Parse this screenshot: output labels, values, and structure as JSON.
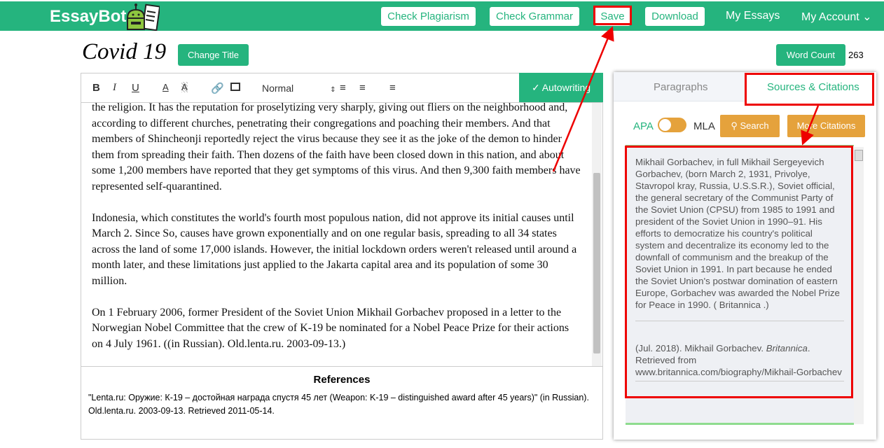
{
  "nav": {
    "brand": "EssayBot",
    "check_plagiarism": "Check Plagiarism",
    "check_grammar": "Check Grammar",
    "save": "Save",
    "download": "Download",
    "my_essays": "My Essays",
    "my_account": "My Account"
  },
  "header": {
    "title": "Covid 19",
    "change_title": "Change Title",
    "word_count_label": "Word Count",
    "word_count": "263"
  },
  "toolbar": {
    "format": "Normal",
    "autowriting": "Autowriting"
  },
  "essay": {
    "paragraphs": [
      "the religion. It has the reputation for proselytizing very sharply, giving out fliers on the neighborhood and, according to different churches, penetrating their congregations and poaching their members. And that members of Shincheonji reportedly reject the virus because they see it as the joke of the demon to hinder them from spreading their faith. Then dozens of the faith have been closed down in this nation, and about some 1,200 members have reported that they get symptoms of this virus. And then 9,300 faith members have represented self-quarantined.",
      "Indonesia, which constitutes the world's fourth most populous nation, did not approve its initial causes until March 2. Since So, causes have grown exponentially and on one regular basis, spreading to all 34 states across the land of some 17,000 islands. However, the initial lockdown orders weren't released until around a month later, and these limitations just applied to the Jakarta capital area and its population of some 30 million.",
      "On 1 February 2006, former President of the Soviet Union Mikhail Gorbachev proposed in a letter to the Norwegian Nobel Committee that the crew of K-19 be nominated for a Nobel Peace Prize for their actions on 4 July 1961. ((in Russian). Old.lenta.ru. 2003-09-13.)"
    ]
  },
  "references": {
    "heading": "References",
    "text": "\"Lenta.ru: Оружие: К-19 – достойная награда спустя 45 лет (Weapon: K-19 – distinguished award after 45 years)\" (in Russian). Old.lenta.ru. 2003-09-13. Retrieved 2011-05-14."
  },
  "panel": {
    "tab_paragraphs": "Paragraphs",
    "tab_sources": "Sources & Citations",
    "apa": "APA",
    "mla": "MLA",
    "search": "Search",
    "more_citations": "More Citations",
    "citation_text": "Mikhail Gorbachev, in full Mikhail Sergeyevich Gorbachev, (born March 2, 1931, Privolye, Stavropol kray, Russia, U.S.S.R.), Soviet official, the general secretary of the Communist Party of the Soviet Union (CPSU) from 1985 to 1991 and president of the Soviet Union in 1990–91. His efforts to democratize his country's political system and decentralize its economy led to the downfall of communism and the breakup of the Soviet Union in 1991. In part because he ended the Soviet Union's postwar domination of eastern Europe, Gorbachev was awarded the Nobel Prize for Peace in 1990. ( Britannica .)",
    "ref_prefix": "(Jul. 2018). Mikhail Gorbachev. ",
    "ref_source": "Britannica",
    "ref_suffix": ". Retrieved from www.britannica.com/biography/Mikhail-Gorbachev"
  }
}
